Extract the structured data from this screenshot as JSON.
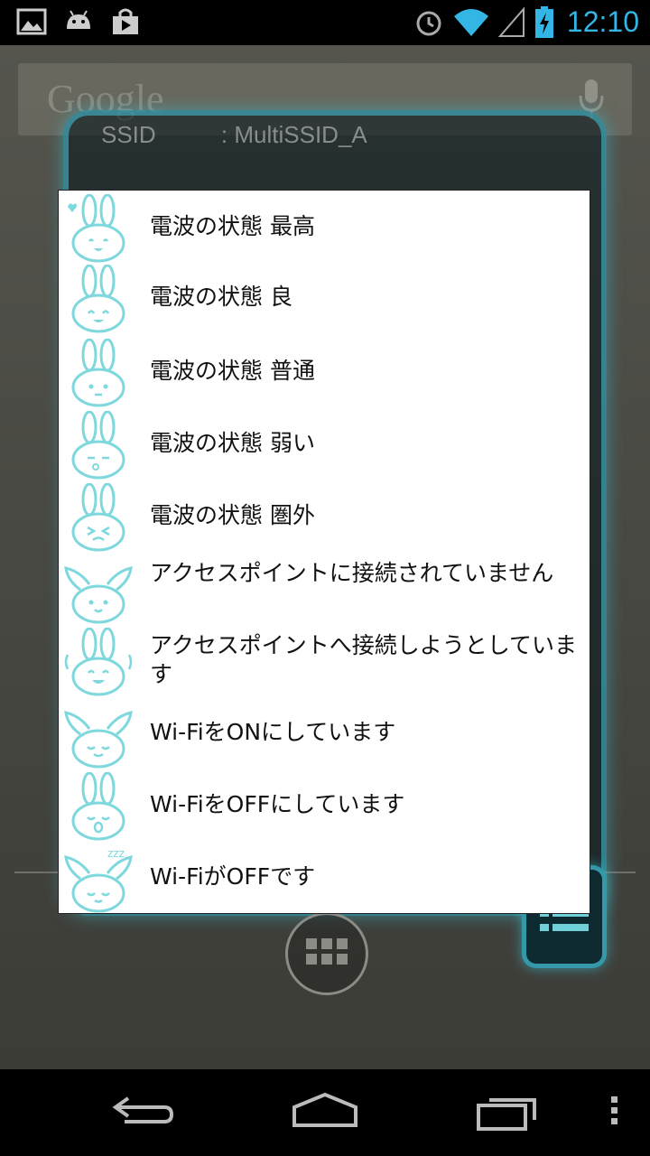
{
  "status_bar": {
    "left_icons": [
      "image-icon",
      "android-icon",
      "play-store-icon"
    ],
    "right_icons": [
      "alarm-icon",
      "wifi-icon",
      "signal-icon",
      "battery-charging-icon"
    ],
    "time": "12:10",
    "accent_color": "#33b5e5"
  },
  "home": {
    "search_logo": "Google",
    "widget_text": "SSID          : MultiSSID_A"
  },
  "dialog": {
    "items": [
      {
        "label": "電波の状態 最高",
        "icon": "bunny-heart-icon"
      },
      {
        "label": "電波の状態 良",
        "icon": "bunny-smile-icon"
      },
      {
        "label": "電波の状態 普通",
        "icon": "bunny-neutral-icon"
      },
      {
        "label": "電波の状態 弱い",
        "icon": "bunny-weak-icon"
      },
      {
        "label": "電波の状態 圏外",
        "icon": "bunny-out-of-range-icon"
      },
      {
        "label": "アクセスポイントに接続されていません",
        "icon": "bunny-droop-ears-icon"
      },
      {
        "label": "アクセスポイントへ接続しようとしています",
        "icon": "bunny-connecting-icon"
      },
      {
        "label": "Wi-FiをONにしています",
        "icon": "bunny-turning-on-icon"
      },
      {
        "label": "Wi-FiをOFFにしています",
        "icon": "bunny-turning-off-icon"
      },
      {
        "label": "Wi-FiがOFFです",
        "icon": "bunny-sleeping-icon"
      }
    ],
    "icon_color": "#7fd8dd"
  },
  "nav_bar": {
    "icons": [
      "back-icon",
      "home-icon",
      "recents-icon",
      "menu-icon"
    ]
  }
}
